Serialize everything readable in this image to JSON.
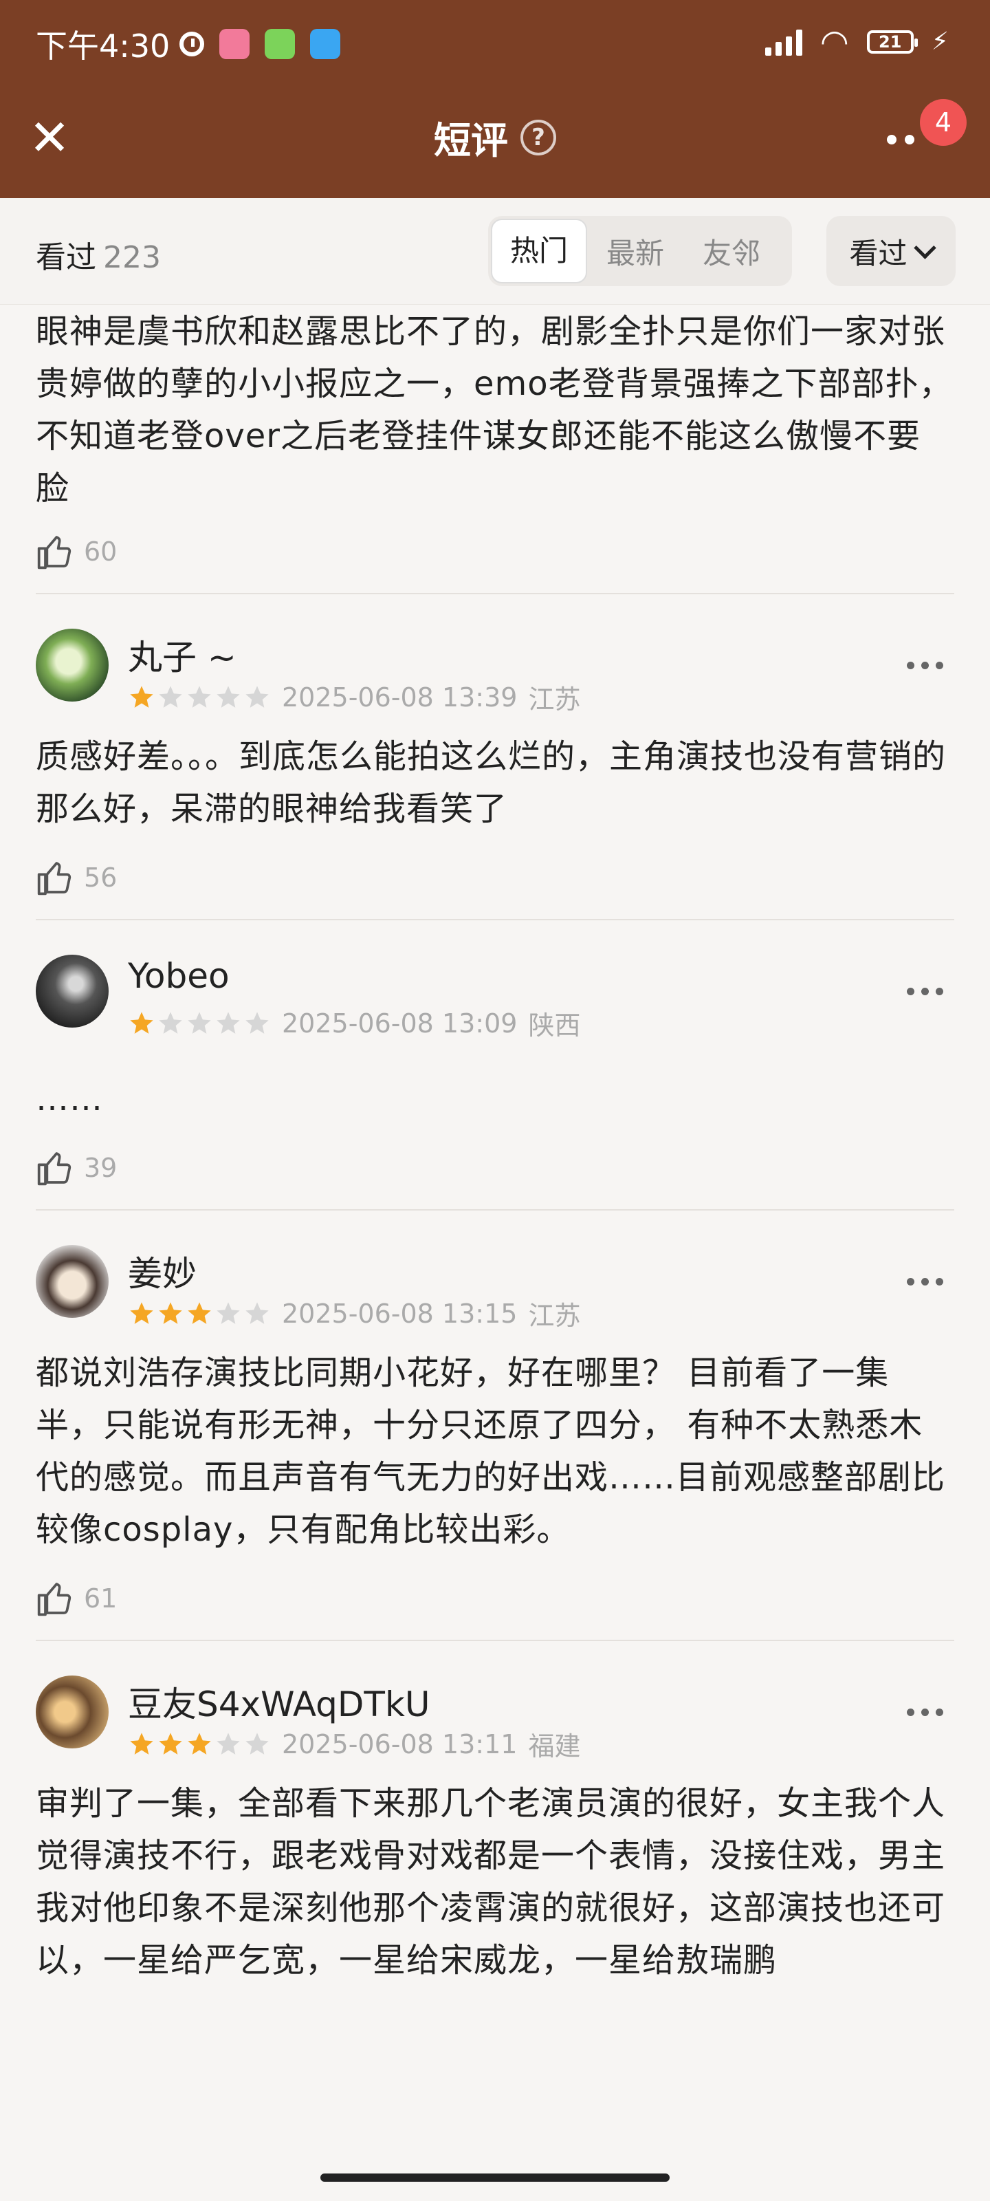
{
  "status_bar": {
    "time": "下午4:30",
    "battery": "21",
    "app_icon_colors": [
      "#f27a9a",
      "#7cd35a",
      "#3aa6f2"
    ]
  },
  "header": {
    "title": "短评",
    "help_icon": "?",
    "notification_count": "4"
  },
  "filter": {
    "seen_label": "看过",
    "seen_count": "223",
    "tabs": [
      "热门",
      "最新",
      "友邻"
    ],
    "dropdown_label": "看过"
  },
  "reviews": [
    {
      "text": "眼神是虞书欣和赵露思比不了的，剧影全扑只是你们一家对张贵婷做的孽的小小报应之一，emo老登背景强捧之下部部扑，不知道老登over之后老登挂件谋女郎还能不能这么傲慢不要脸",
      "likes": "60"
    },
    {
      "name": "丸子 ~",
      "rating": 1,
      "date": "2025-06-08 13:39",
      "location": "江苏",
      "text": "质感好差。。。到底怎么能拍这么烂的，主角演技也没有营销的那么好，呆滞的眼神给我看笑了",
      "likes": "56"
    },
    {
      "name": "Yobeo",
      "rating": 1,
      "date": "2025-06-08 13:09",
      "location": "陕西",
      "text": "……",
      "likes": "39"
    },
    {
      "name": "姜妙",
      "rating": 3,
      "date": "2025-06-08 13:15",
      "location": "江苏",
      "text": "都说刘浩存演技比同期小花好，好在哪里？ 目前看了一集半，只能说有形无神，十分只还原了四分， 有种不太熟悉木代的感觉。而且声音有气无力的好出戏……目前观感整部剧比较像cosplay，只有配角比较出彩。",
      "likes": "61"
    },
    {
      "name": "豆友S4xWAqDTkU",
      "rating": 3,
      "date": "2025-06-08 13:11",
      "location": "福建",
      "text": "审判了一集，全部看下来那几个老演员演的很好，女主我个人觉得演技不行，跟老戏骨对戏都是一个表情，没接住戏，男主我对他印象不是深刻他那个凌霄演的就很好，这部演技也还可以，一星给严乞宽，一星给宋威龙，一星给敖瑞鹏"
    }
  ],
  "colors": {
    "header_bg": "#7b3f25",
    "star_on": "#f5a623",
    "star_off": "#d6d6d6",
    "badge": "#f05454"
  }
}
